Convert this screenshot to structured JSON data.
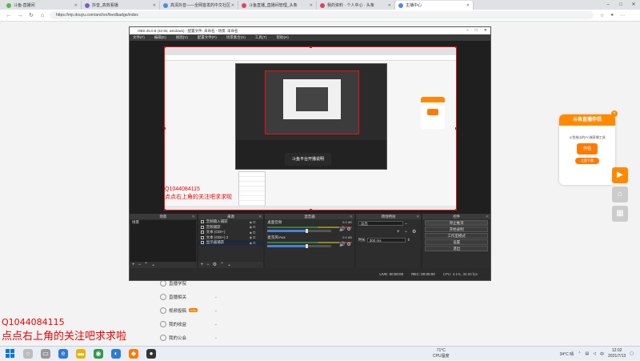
{
  "browser": {
    "tabs": [
      {
        "label": "斗鱼-直播间",
        "color": "#56b947",
        "active": false
      },
      {
        "label": "抖音_高效看播",
        "color": "#7b5bd6",
        "active": false
      },
      {
        "label": "高清抖音——全网首发的中文社区",
        "color": "#4b87f1",
        "active": false
      },
      {
        "label": "斗鱼直播_直播间管理_头条",
        "color": "#e4405f",
        "active": false
      },
      {
        "label": "我的资料 · 个人中心 · 头条",
        "color": "#e4405f",
        "active": false
      },
      {
        "label": "主播中心",
        "color": "#4b87f1",
        "active": true
      }
    ],
    "url": "https://mp.douyu.com/anchor/feedbadge/index",
    "window_controls": [
      "–",
      "□",
      "✕"
    ]
  },
  "subnav": {
    "items": [
      {
        "label": "直播学院",
        "badge": ""
      },
      {
        "label": "直播相关",
        "badge": ""
      },
      {
        "label": "视频投稿",
        "badge": "new"
      },
      {
        "label": "我的收益",
        "badge": ""
      },
      {
        "label": "我的公会",
        "badge": ""
      }
    ]
  },
  "overlay": {
    "line1": "Q1044084115",
    "line2": "点点右上角的关注吧求求啦"
  },
  "promo": {
    "title": "斗鱼直播伴侣",
    "description": "斗鱼推出的PC端直播工具",
    "logo_text": "伴侣",
    "button": "立即下载"
  },
  "obs": {
    "title": "OBS 25.0.8 (32-bit, windows) - 配置文件: 未命名 - 场景: 未命名",
    "menu": [
      "文件(F)",
      "编辑(E)",
      "视图(V)",
      "配置文件(P)",
      "场景集合(S)",
      "工具(T)",
      "帮助(H)"
    ],
    "nested_toast": "斗鱼平台开播说明",
    "docks": {
      "scenes": {
        "title": "场景",
        "items": [
          "场景"
        ]
      },
      "sources": {
        "title": "来源",
        "items": [
          "音频输入捕获",
          "音频捕获",
          "文本 (GDI+)",
          "文本 (GDI+) 2",
          "显示器捕获"
        ]
      },
      "mixer": {
        "title": "混音器",
        "channels": [
          {
            "name": "桌面音频",
            "db": "0.0 dB"
          },
          {
            "name": "麦克风/Aux",
            "db": "0.0 dB"
          }
        ]
      },
      "transitions": {
        "title": "转场特效",
        "type": "淡出",
        "duration_label": "时长",
        "duration": "300 ms"
      },
      "controls": {
        "title": "控件",
        "buttons": [
          "停止推流",
          "开始录制",
          "工作室模式",
          "设置",
          "退出"
        ]
      }
    },
    "status": {
      "live": "LIVE: 00:00:00",
      "rec": "REC: 00:00:00",
      "cpu": "CPU: 3.1%, 30.00 fps"
    }
  },
  "taskbar": {
    "weather_temp": "71°C",
    "weather_label": "CPU温度",
    "tray_weather": "34°C 晴",
    "time": "12:02",
    "date": "2021/7/13"
  }
}
